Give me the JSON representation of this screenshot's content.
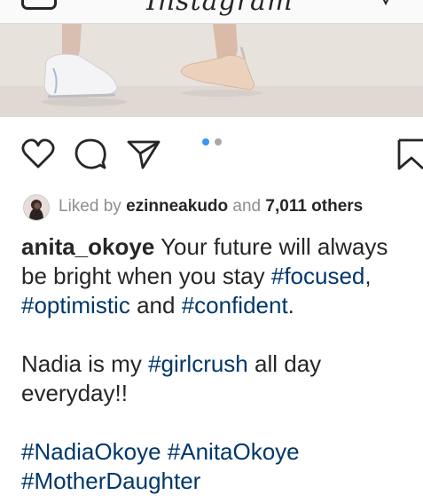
{
  "header": {
    "logo_text": "Instagram"
  },
  "carousel": {
    "total_slides": 2,
    "active_slide": 1,
    "active_color": "#3897f0",
    "inactive_color": "#a8a8a8"
  },
  "likes": {
    "prefix": "Liked by",
    "user": "ezinneakudo",
    "joiner": "and",
    "others": "7,011 others"
  },
  "caption": {
    "username": "anita_okoye",
    "line1_text": "Your future will always be bright when you stay",
    "tag_focused": "#focused",
    "comma": ",",
    "tag_optimistic": "#optimistic",
    "and": "and",
    "tag_confident": "#confident",
    "period": ".",
    "para2_start": "Nadia is my",
    "tag_girlcrush": "#girlcrush",
    "para2_end": "all day everyday!!",
    "tag_nadia": "#NadiaOkoye",
    "tag_anita": "#AnitaOkoye",
    "tag_motherdaughter": "#MotherDaughter"
  },
  "icons": {
    "like": "heart-icon",
    "comment": "comment-icon",
    "share": "paper-plane-icon",
    "save": "bookmark-icon",
    "camera": "camera-icon",
    "direct": "direct-message-icon"
  }
}
